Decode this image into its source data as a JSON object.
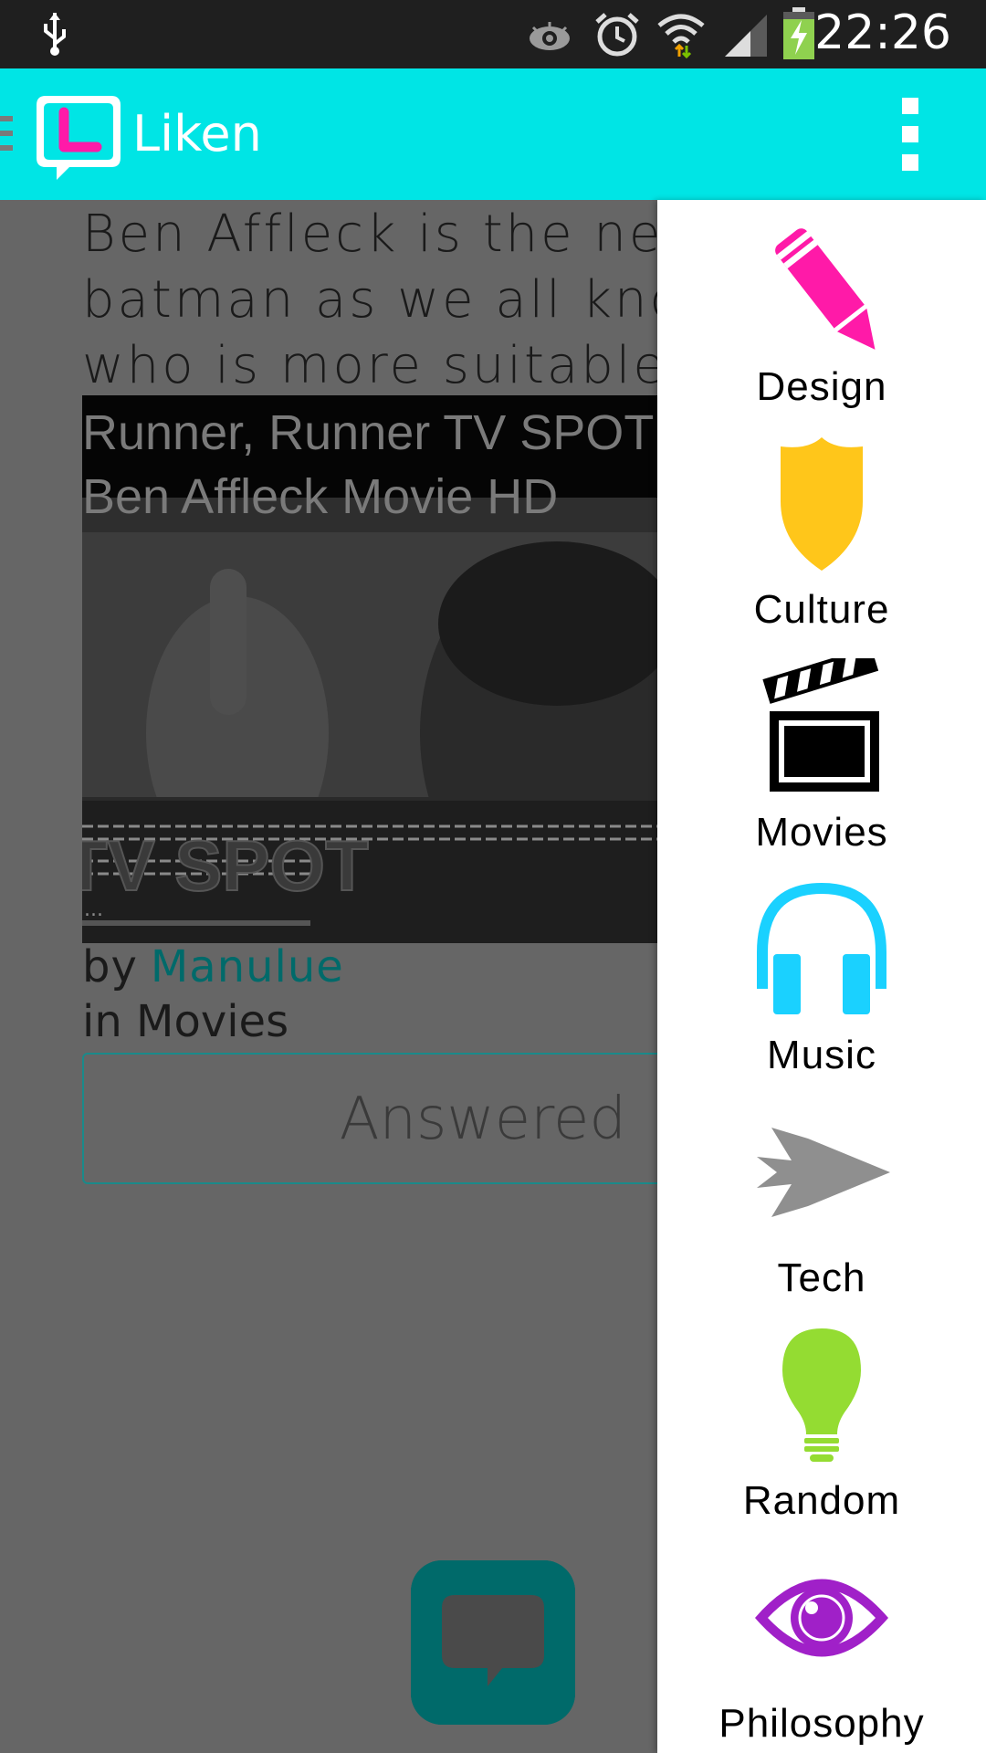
{
  "status_bar": {
    "time": "22:26",
    "icons": [
      "usb-icon",
      "eye-icon",
      "alarm-icon",
      "wifi-icon",
      "signal-icon",
      "battery-charging-icon"
    ]
  },
  "app_bar": {
    "title": "Liken",
    "logo_icon": "liken-logo-icon",
    "menu_icon": "overflow-menu-icon"
  },
  "post": {
    "text_lines": [
      "Ben Affleck is the new",
      "batman as we all know",
      "who is more suitable to"
    ],
    "video": {
      "title_lines": [
        "Runner, Runner TV SPOT",
        "Ben Affleck Movie HD"
      ],
      "overlay_text": "TV SPOT",
      "dots": "..."
    },
    "by_label": "by",
    "author": "Manulue",
    "in_label": "in",
    "category": "Movies",
    "answered_label": "Answered"
  },
  "drawer": {
    "items": [
      {
        "label": "Design",
        "icon": "pencil-icon",
        "color": "#ff1aa8"
      },
      {
        "label": "Culture",
        "icon": "shield-icon",
        "color": "#ffc61a"
      },
      {
        "label": "Movies",
        "icon": "clapperboard-icon",
        "color": "#000000"
      },
      {
        "label": "Music",
        "icon": "headphones-icon",
        "color": "#1ad1ff"
      },
      {
        "label": "Tech",
        "icon": "plane-icon",
        "color": "#8f8f8f"
      },
      {
        "label": "Random",
        "icon": "lightbulb-icon",
        "color": "#94dc32"
      },
      {
        "label": "Philosophy",
        "icon": "eye-icon",
        "color": "#a020c8"
      }
    ]
  },
  "colors": {
    "app_bar": "#00e5e5",
    "accent": "#006a6a",
    "scrim": "#666666"
  }
}
